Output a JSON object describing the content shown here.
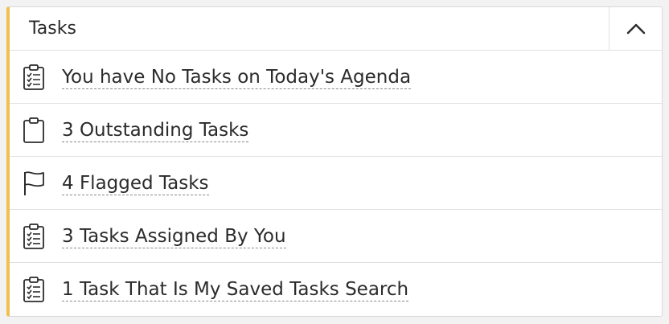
{
  "panel": {
    "title": "Tasks",
    "accent_color": "#f0c04f",
    "collapse_icon": "chevron-up-icon"
  },
  "rows": [
    {
      "icon": "clipboard-checklist-icon",
      "label": "You have No Tasks on Today's Agenda"
    },
    {
      "icon": "clipboard-icon",
      "label": "3 Outstanding Tasks"
    },
    {
      "icon": "flag-icon",
      "label": "4 Flagged Tasks"
    },
    {
      "icon": "clipboard-checklist-icon",
      "label": "3 Tasks Assigned By You"
    },
    {
      "icon": "clipboard-checklist-icon",
      "label": "1 Task That Is My Saved Tasks Search"
    }
  ]
}
